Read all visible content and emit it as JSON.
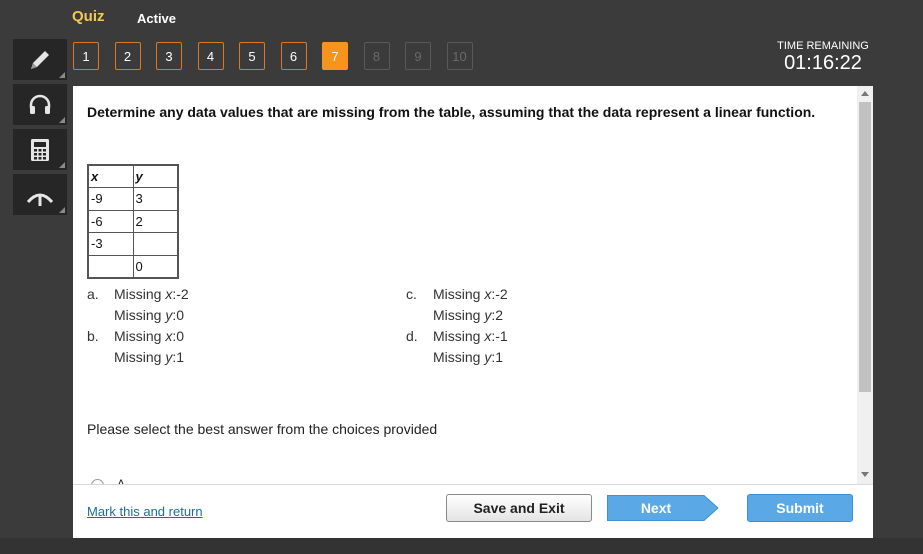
{
  "header": {
    "title": "Quiz",
    "status": "Active"
  },
  "toolbar": {
    "tools": [
      {
        "name": "pencil-icon"
      },
      {
        "name": "headphones-icon"
      },
      {
        "name": "calculator-icon"
      },
      {
        "name": "reference-icon"
      }
    ]
  },
  "question_nav": {
    "buttons": [
      {
        "label": "1",
        "state": "answered"
      },
      {
        "label": "2",
        "state": "answered"
      },
      {
        "label": "3",
        "state": "answered"
      },
      {
        "label": "4",
        "state": "answered"
      },
      {
        "label": "5",
        "state": "answered"
      },
      {
        "label": "6",
        "state": "answered"
      },
      {
        "label": "7",
        "state": "current"
      },
      {
        "label": "8",
        "state": "disabled"
      },
      {
        "label": "9",
        "state": "disabled"
      },
      {
        "label": "10",
        "state": "disabled"
      }
    ]
  },
  "timer": {
    "label": "TIME REMAINING",
    "value": "01:16:22"
  },
  "question": {
    "text": "Determine any data values that are missing from the table, assuming that the data represent a linear function.",
    "table": {
      "headers": [
        "x",
        "y"
      ],
      "rows": [
        [
          "-9",
          "3"
        ],
        [
          "-6",
          "2"
        ],
        [
          "-3",
          ""
        ],
        [
          "",
          "0"
        ]
      ]
    },
    "choices": [
      {
        "letter": "a.",
        "x_label": "Missing ",
        "x_var": "x",
        "x_value": ":-2",
        "y_label": "Missing ",
        "y_var": "y",
        "y_value": ":0"
      },
      {
        "letter": "b.",
        "x_label": "Missing ",
        "x_var": "x",
        "x_value": ":0",
        "y_label": "Missing ",
        "y_var": "y",
        "y_value": ":1"
      },
      {
        "letter": "c.",
        "x_label": "Missing ",
        "x_var": "x",
        "x_value": ":-2",
        "y_label": "Missing ",
        "y_var": "y",
        "y_value": ":2"
      },
      {
        "letter": "d.",
        "x_label": "Missing ",
        "x_var": "x",
        "x_value": ":-1",
        "y_label": "Missing ",
        "y_var": "y",
        "y_value": ":1"
      }
    ],
    "instruction": "Please select the best answer from the choices provided",
    "first_option_peek": "A"
  },
  "footer": {
    "mark_link": "Mark this and return",
    "save_label": "Save and Exit",
    "next_label": "Next",
    "submit_label": "Submit"
  },
  "colors": {
    "accent": "#f7941d",
    "button_blue": "#5aa9e6",
    "header_yellow": "#f2c94c",
    "link": "#1a6e9a"
  }
}
